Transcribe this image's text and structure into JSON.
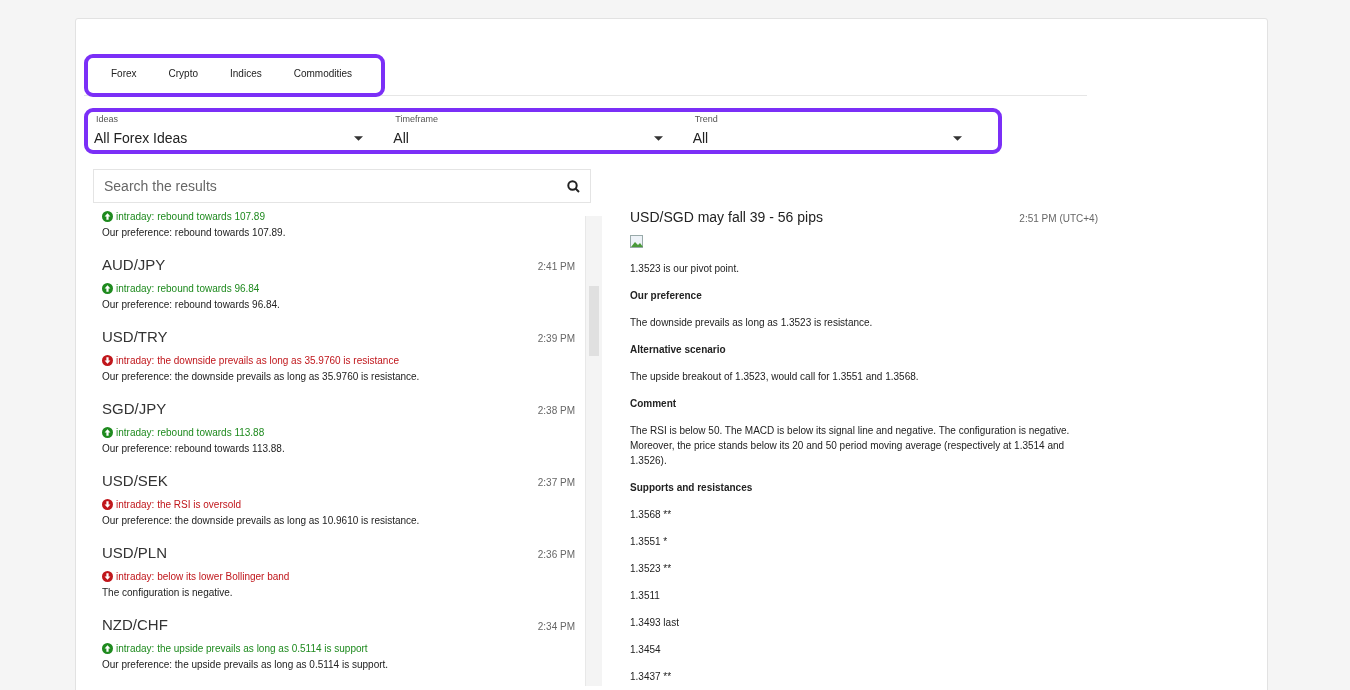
{
  "tabs": [
    {
      "label": "Forex",
      "selected": false
    },
    {
      "label": "Crypto",
      "selected": false
    },
    {
      "label": "Indices",
      "selected": false
    },
    {
      "label": "Commodities",
      "selected": false
    }
  ],
  "filters": [
    {
      "label": "Ideas",
      "value": "All Forex Ideas"
    },
    {
      "label": "Timeframe",
      "value": "All"
    },
    {
      "label": "Trend",
      "value": "All"
    }
  ],
  "search": {
    "placeholder": "Search the results"
  },
  "ideas": [
    {
      "kind": "up",
      "signal": "intraday: rebound towards 107.89",
      "preference": "Our preference: rebound towards 107.89."
    },
    {
      "pair": "AUD/JPY",
      "time": "2:41 PM",
      "kind": "up",
      "signal": "intraday: rebound towards 96.84",
      "preference": "Our preference: rebound towards 96.84."
    },
    {
      "pair": "USD/TRY",
      "time": "2:39 PM",
      "kind": "down",
      "signal": "intraday: the downside prevails as long as 35.9760 is resistance",
      "preference": "Our preference: the downside prevails as long as 35.9760 is resistance."
    },
    {
      "pair": "SGD/JPY",
      "time": "2:38 PM",
      "kind": "up",
      "signal": "intraday: rebound towards 113.88",
      "preference": "Our preference: rebound towards 113.88."
    },
    {
      "pair": "USD/SEK",
      "time": "2:37 PM",
      "kind": "down",
      "signal": "intraday: the RSI is oversold",
      "preference": "Our preference: the downside prevails as long as 10.9610 is resistance."
    },
    {
      "pair": "USD/PLN",
      "time": "2:36 PM",
      "kind": "down",
      "signal": "intraday: below its lower Bollinger band",
      "preference": "The configuration is negative."
    },
    {
      "pair": "NZD/CHF",
      "time": "2:34 PM",
      "kind": "up",
      "signal": "intraday: the upside prevails as long as 0.5114 is support",
      "preference": "Our preference: the upside prevails as long as 0.5114 is support."
    }
  ],
  "article": {
    "title": "USD/SGD may fall 39 - 56 pips",
    "time": "2:51 PM (UTC+4)",
    "blocks": [
      {
        "kind": "text",
        "text": "1.3523 is our pivot point."
      },
      {
        "kind": "heading",
        "text": "Our preference"
      },
      {
        "kind": "text",
        "text": "The downside prevails as long as 1.3523 is resistance."
      },
      {
        "kind": "heading",
        "text": "Alternative scenario"
      },
      {
        "kind": "text",
        "text": "The upside breakout of 1.3523, would call for 1.3551 and 1.3568."
      },
      {
        "kind": "heading",
        "text": "Comment"
      },
      {
        "kind": "text",
        "text": "The RSI is below 50. The MACD is below its signal line and negative. The configuration is negative. Moreover, the price stands below its 20 and 50 period moving average (respectively at 1.3514 and 1.3526)."
      },
      {
        "kind": "heading",
        "text": "Supports and resistances"
      },
      {
        "kind": "text",
        "text": "1.3568 **"
      },
      {
        "kind": "text",
        "text": "1.3551 *"
      },
      {
        "kind": "text",
        "text": "1.3523 **"
      },
      {
        "kind": "text",
        "text": "1.3511"
      },
      {
        "kind": "text",
        "text": "1.3493 last"
      },
      {
        "kind": "text",
        "text": "1.3454"
      },
      {
        "kind": "text",
        "text": "1.3437 **"
      }
    ]
  }
}
